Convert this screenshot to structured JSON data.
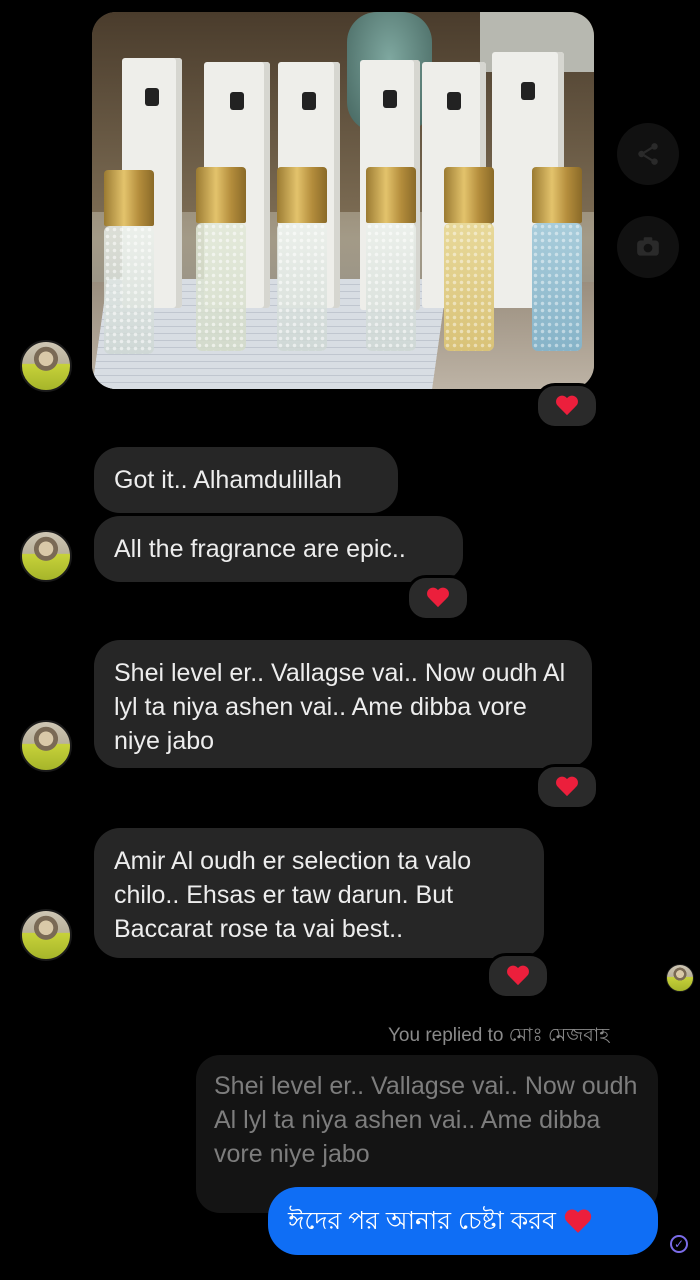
{
  "thread": {
    "messages": [
      {
        "text": "Got it.. Alhamdulillah"
      },
      {
        "text": "All the fragrance are epic.."
      },
      {
        "text": "Shei level er.. Vallagse vai.. Now oudh Al lyl ta niya ashen vai.. Ame dibba vore niye jabo"
      },
      {
        "text": "Amir Al oudh er selection ta valo chilo.. Ehsas er taw darun. But Baccarat rose ta vai best.."
      }
    ],
    "reaction_icon": "heart-reaction-icon",
    "reaction_color": "#ec1f3c"
  },
  "photo": {
    "label_texts": [
      "AMYAE",
      "Al Ou",
      "BACCARA",
      "DALA",
      "EHSAS",
      "Cool W"
    ]
  },
  "reply": {
    "context_label": "You replied to মোঃ মেজবাহ",
    "quoted_text": "Shei level er.. Vallagse vai.. Now oudh Al lyl ta niya ashen vai.. Ame dibba vore niye jabo",
    "sent_text": "ঈদের পর আনার চেষ্টা করব"
  },
  "colors": {
    "background": "#000000",
    "incoming_bubble": "#262626",
    "outgoing_bubble": "#0f6ef5",
    "seen_indicator": "#7b6ce8"
  }
}
